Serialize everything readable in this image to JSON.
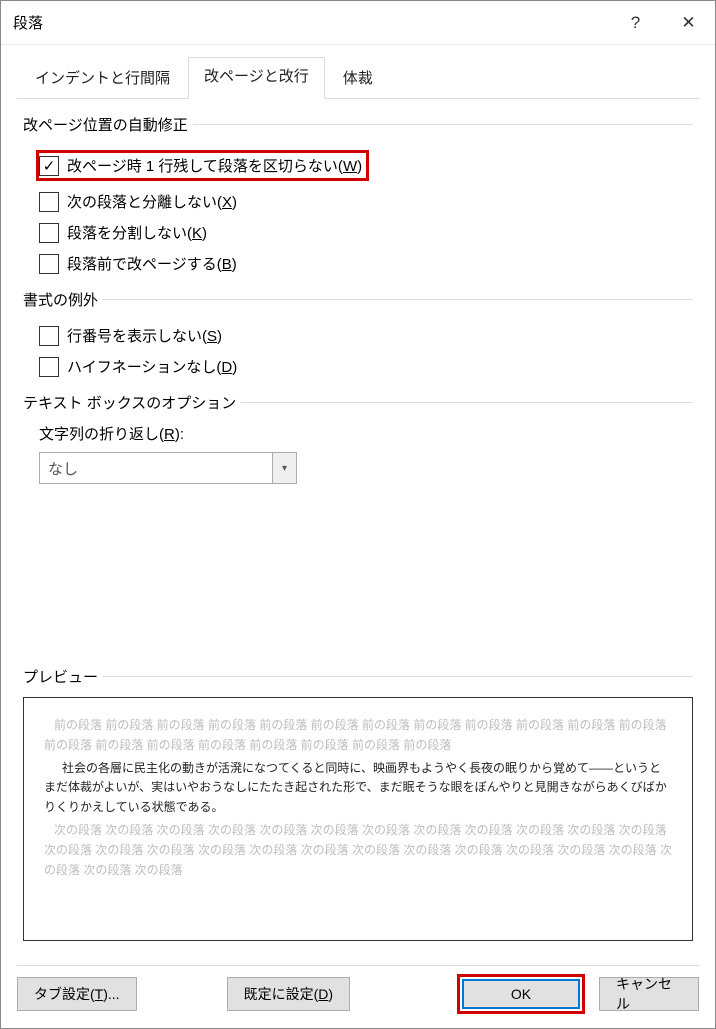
{
  "titlebar": {
    "title": "段落",
    "help": "?",
    "close": "✕"
  },
  "tabs": {
    "tab1": "インデントと行間隔",
    "tab2": "改ページと改行",
    "tab3": "体裁"
  },
  "group1": {
    "title": "改ページ位置の自動修正",
    "cb1_a": "改ページ時 1 行残して段落を区切らない(",
    "cb1_b": "W",
    "cb1_c": ")",
    "cb2_a": "次の段落と分離しない(",
    "cb2_b": "X",
    "cb2_c": ")",
    "cb3_a": "段落を分割しない(",
    "cb3_b": "K",
    "cb3_c": ")",
    "cb4_a": "段落前で改ページする(",
    "cb4_b": "B",
    "cb4_c": ")"
  },
  "group2": {
    "title": "書式の例外",
    "cb1_a": "行番号を表示しない(",
    "cb1_b": "S",
    "cb1_c": ")",
    "cb2_a": "ハイフネーションなし(",
    "cb2_b": "D",
    "cb2_c": ")"
  },
  "group3": {
    "title": "テキスト ボックスのオプション",
    "label_a": "文字列の折り返し(",
    "label_b": "R",
    "label_c": "):",
    "value": "なし"
  },
  "preview": {
    "title": "プレビュー",
    "gray1": "前の段落 前の段落 前の段落 前の段落 前の段落 前の段落 前の段落 前の段落 前の段落 前の段落 前の段落 前の段落 前の段落 前の段落 前の段落 前の段落 前の段落 前の段落 前の段落 前の段落",
    "black": "社会の各層に民主化の動きが活溌になつてくると同時に、映画界もようやく長夜の眠りから覚めて――というとまだ体裁がよいが、実はいやおうなしにたたき起された形で、まだ眠そうな眼をぼんやりと見開きながらあくびばかりくりかえしている状態である。",
    "gray2": "次の段落 次の段落 次の段落 次の段落 次の段落 次の段落 次の段落 次の段落 次の段落 次の段落 次の段落 次の段落 次の段落 次の段落 次の段落 次の段落 次の段落 次の段落 次の段落 次の段落 次の段落 次の段落 次の段落 次の段落 次の段落 次の段落 次の段落"
  },
  "buttons": {
    "tab_settings_a": "タブ設定(",
    "tab_settings_b": "T",
    "tab_settings_c": ")...",
    "default_a": "既定に設定(",
    "default_b": "D",
    "default_c": ")",
    "ok": "OK",
    "cancel": "キャンセル"
  }
}
